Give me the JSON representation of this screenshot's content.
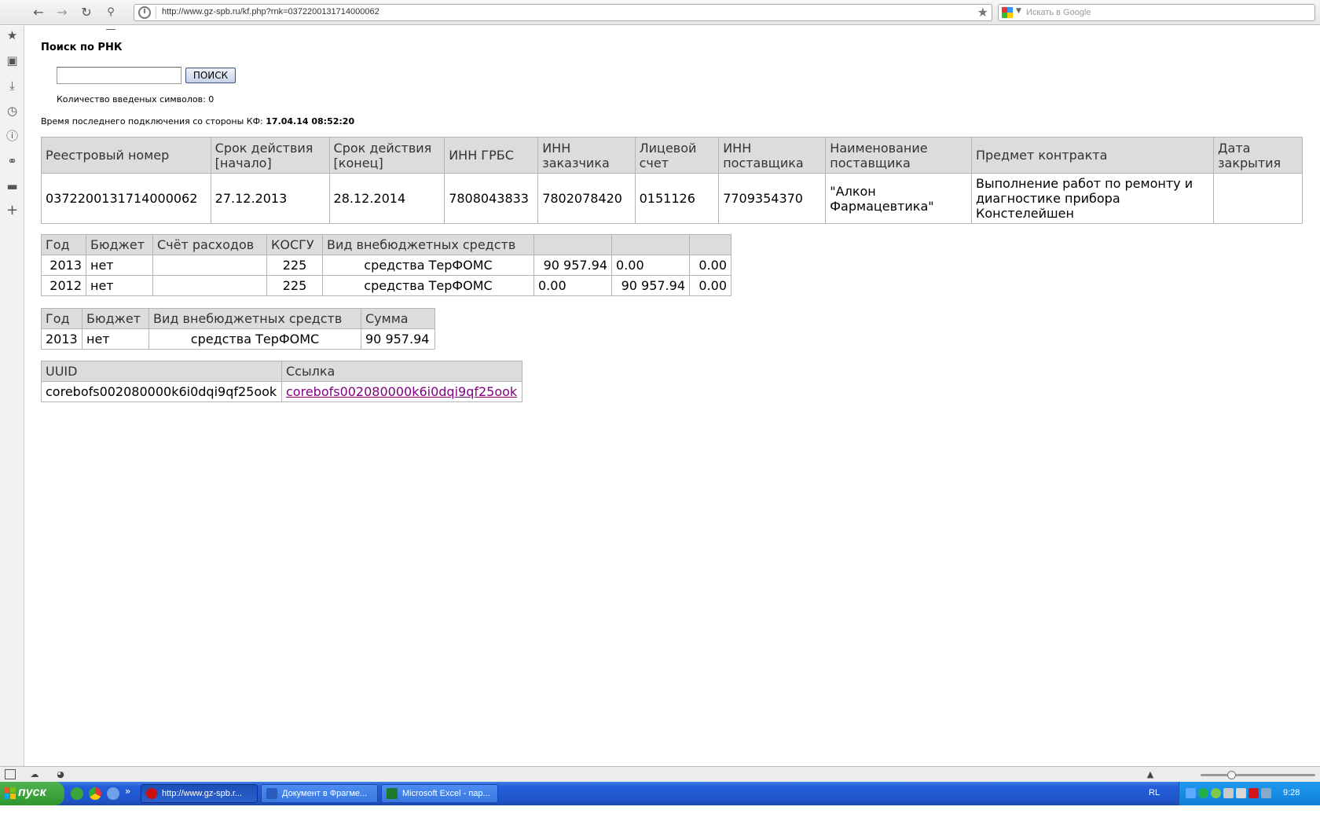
{
  "browser": {
    "url": "http://www.gz-spb.ru/kf.php?rnk=0372200131714000062",
    "search_placeholder": "Искать в Google"
  },
  "page": {
    "title": "Поиск по РНК",
    "search_button": "ПОИСК",
    "search_value": "",
    "char_count_label": "Количество введеных символов: 0",
    "last_connection_label": "Время последнего подключения со стороны КФ:",
    "last_connection_value": "17.04.14 08:52:20"
  },
  "contract_table": {
    "headers": [
      "Реестровый номер",
      "Срок действия [начало]",
      "Срок действия [конец]",
      "ИНН ГРБС",
      "ИНН заказчика",
      "Лицевой счет",
      "ИНН поставщика",
      "Наименование поставщика",
      "Предмет контракта",
      "Дата закрытия"
    ],
    "rows": [
      [
        "0372200131714000062",
        "27.12.2013",
        "28.12.2014",
        "7808043833",
        "7802078420",
        "0151126",
        "7709354370",
        "\"Алкон Фармацевтика\"",
        "Выполнение работ по ремонту и диагностике прибора Констелейшен",
        ""
      ]
    ]
  },
  "finance_table": {
    "headers": [
      "Год",
      "Бюджет",
      "Счёт расходов",
      "КОСГУ",
      "Вид внебюджетных средств",
      "",
      "",
      ""
    ],
    "rows": [
      [
        "2013",
        "нет",
        "",
        "225",
        "средства ТерФОМС",
        "90 957.94",
        "0.00",
        "0.00"
      ],
      [
        "2012",
        "нет",
        "",
        "225",
        "средства ТерФОМС",
        "0.00",
        "90 957.94",
        "0.00"
      ]
    ]
  },
  "budget_table": {
    "headers": [
      "Год",
      "Бюджет",
      "Вид внебюджетных средств",
      "Сумма"
    ],
    "rows": [
      [
        "2013",
        "нет",
        "средства ТерФОМС",
        "90 957.94"
      ]
    ]
  },
  "uuid_table": {
    "headers": [
      "UUID",
      "Ссылка"
    ],
    "uuid": "corebofs002080000k6i0dqi9qf25ook",
    "link": "corebofs002080000k6i0dqi9qf25ook"
  },
  "taskbar": {
    "start_label": "пуск",
    "tasks": [
      {
        "label": "http://www.gz-spb.r...",
        "icon_color": "#cc1010",
        "active": true
      },
      {
        "label": "Документ в Фрагме...",
        "icon_color": "#2a5bbd",
        "active": false
      },
      {
        "label": "Microsoft Excel - пар...",
        "icon_color": "#1d7a2c",
        "active": false
      }
    ],
    "language": "RL",
    "clock": "9:28"
  },
  "icons": {
    "back": "arrow-left-icon",
    "forward": "arrow-right-icon",
    "reload": "reload-icon",
    "key": "key-icon",
    "star": "star-icon"
  }
}
